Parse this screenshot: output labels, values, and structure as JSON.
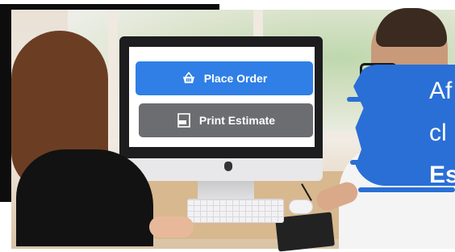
{
  "screen": {
    "place_order_label": "Place Order",
    "print_estimate_label": "Print Estimate",
    "place_order_icon": "basket-icon",
    "print_estimate_icon": "pdf-document-icon"
  },
  "promo": {
    "line1": "Af",
    "line2": "cl",
    "line3": "Es"
  },
  "colors": {
    "place_order": "#2f7fe6",
    "print_estimate": "#6c6d70",
    "brand_brush": "#2a6fd6"
  }
}
